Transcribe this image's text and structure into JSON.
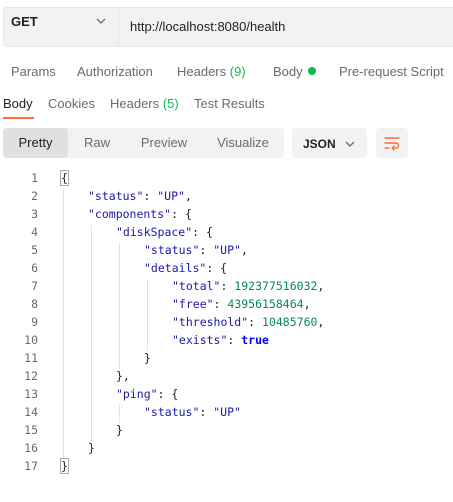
{
  "request": {
    "method": "GET",
    "url": "http://localhost:8080/health"
  },
  "request_tabs": {
    "params": "Params",
    "authorization": "Authorization",
    "headers": "Headers",
    "headers_count": "(9)",
    "body": "Body",
    "prerequest": "Pre-request Script"
  },
  "response_tabs": {
    "body": "Body",
    "cookies": "Cookies",
    "headers": "Headers",
    "headers_count": "(5)",
    "test_results": "Test Results"
  },
  "view_modes": [
    "Pretty",
    "Raw",
    "Preview",
    "Visualize"
  ],
  "active_view": "Pretty",
  "format": "JSON",
  "colors": {
    "accent": "#ff6c37",
    "status_green": "#0cbb52",
    "key_blue": "#1a1aa6",
    "number_green": "#098658",
    "bool_blue": "#0000ff"
  },
  "response_json": {
    "lines": [
      {
        "n": "1",
        "text": "{"
      },
      {
        "n": "2",
        "key": "\"status\"",
        "value": "\"UP\"",
        "tail": ","
      },
      {
        "n": "3",
        "key": "\"components\"",
        "tail": ": {"
      },
      {
        "n": "4",
        "key": "\"diskSpace\"",
        "tail": ": {"
      },
      {
        "n": "5",
        "key": "\"status\"",
        "value": "\"UP\"",
        "tail": ","
      },
      {
        "n": "6",
        "key": "\"details\"",
        "tail": ": {"
      },
      {
        "n": "7",
        "key": "\"total\"",
        "value": "192377516032",
        "tail": ","
      },
      {
        "n": "8",
        "key": "\"free\"",
        "value": "43956158464",
        "tail": ","
      },
      {
        "n": "9",
        "key": "\"threshold\"",
        "value": "10485760",
        "tail": ","
      },
      {
        "n": "10",
        "key": "\"exists\"",
        "value": "true"
      },
      {
        "n": "11",
        "text": "}"
      },
      {
        "n": "12",
        "text": "},"
      },
      {
        "n": "13",
        "key": "\"ping\"",
        "tail": ": {"
      },
      {
        "n": "14",
        "key": "\"status\"",
        "value": "\"UP\""
      },
      {
        "n": "15",
        "text": "}"
      },
      {
        "n": "16",
        "text": "}"
      },
      {
        "n": "17",
        "text": "}"
      }
    ]
  },
  "icons": {
    "method_dropdown": "chevron-down-icon",
    "format_dropdown": "chevron-down-icon",
    "wrap": "wrap-lines-icon",
    "body_indicator": "dot-icon"
  }
}
